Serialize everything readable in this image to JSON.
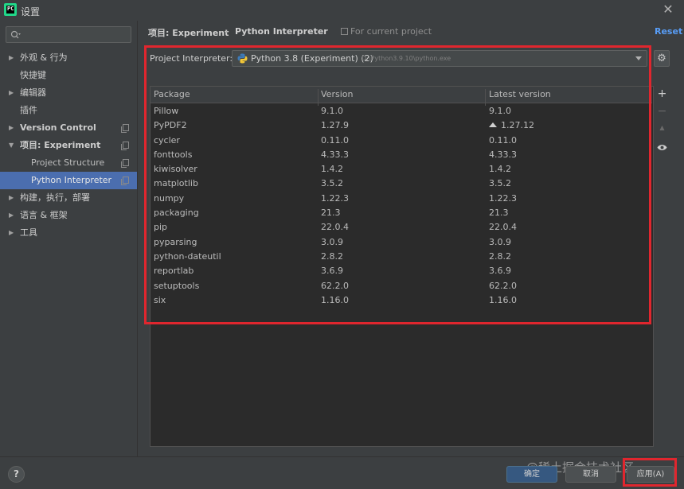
{
  "window": {
    "title": "设置"
  },
  "search": {
    "placeholder": ""
  },
  "sidebar": {
    "items": [
      {
        "label": "外观 & 行为",
        "arrow": "▶",
        "bold": false
      },
      {
        "label": "快捷键",
        "arrow": "",
        "bold": false
      },
      {
        "label": "编辑器",
        "arrow": "▶",
        "bold": false
      },
      {
        "label": "插件",
        "arrow": "",
        "bold": false
      },
      {
        "label": "Version Control",
        "arrow": "▶",
        "bold": true
      },
      {
        "label": "项目: Experiment",
        "arrow": "▼",
        "bold": true
      },
      {
        "label": "Project Structure",
        "arrow": "",
        "bold": false
      },
      {
        "label": "Python Interpreter",
        "arrow": "",
        "bold": false
      },
      {
        "label": "构建，执行，部署",
        "arrow": "▶",
        "bold": false
      },
      {
        "label": "语言 & 框架",
        "arrow": "▶",
        "bold": false
      },
      {
        "label": "工具",
        "arrow": "▶",
        "bold": false
      }
    ]
  },
  "breadcrumb": {
    "project": "项目: Experiment",
    "separator": "›",
    "page": "Python Interpreter",
    "scope": "For current project"
  },
  "reset_label": "Reset",
  "interpreter": {
    "label": "Project Interpreter:",
    "name": "Python 3.8 (Experiment) (2)",
    "path": "D:\\Python3.9.10\\python.exe"
  },
  "packages": {
    "headers": [
      "Package",
      "Version",
      "Latest version"
    ],
    "rows": [
      {
        "name": "Pillow",
        "version": "9.1.0",
        "latest": "9.1.0",
        "upgrade": false
      },
      {
        "name": "PyPDF2",
        "version": "1.27.9",
        "latest": "1.27.12",
        "upgrade": true
      },
      {
        "name": "cycler",
        "version": "0.11.0",
        "latest": "0.11.0",
        "upgrade": false
      },
      {
        "name": "fonttools",
        "version": "4.33.3",
        "latest": "4.33.3",
        "upgrade": false
      },
      {
        "name": "kiwisolver",
        "version": "1.4.2",
        "latest": "1.4.2",
        "upgrade": false
      },
      {
        "name": "matplotlib",
        "version": "3.5.2",
        "latest": "3.5.2",
        "upgrade": false
      },
      {
        "name": "numpy",
        "version": "1.22.3",
        "latest": "1.22.3",
        "upgrade": false
      },
      {
        "name": "packaging",
        "version": "21.3",
        "latest": "21.3",
        "upgrade": false
      },
      {
        "name": "pip",
        "version": "22.0.4",
        "latest": "22.0.4",
        "upgrade": false
      },
      {
        "name": "pyparsing",
        "version": "3.0.9",
        "latest": "3.0.9",
        "upgrade": false
      },
      {
        "name": "python-dateutil",
        "version": "2.8.2",
        "latest": "2.8.2",
        "upgrade": false
      },
      {
        "name": "reportlab",
        "version": "3.6.9",
        "latest": "3.6.9",
        "upgrade": false
      },
      {
        "name": "setuptools",
        "version": "62.2.0",
        "latest": "62.2.0",
        "upgrade": false
      },
      {
        "name": "six",
        "version": "1.16.0",
        "latest": "1.16.0",
        "upgrade": false
      }
    ]
  },
  "tools": {
    "add": "+",
    "remove": "−",
    "upgrade": "▲"
  },
  "footer": {
    "help": "?",
    "ok": "确定",
    "cancel": "取消",
    "apply": "应用(A)",
    "watermark": "@稀土掘金技术社区"
  },
  "colors": {
    "accent": "#4b6eaf",
    "link": "#589df6",
    "highlight": "#e0262e",
    "primary_button": "#365880"
  }
}
